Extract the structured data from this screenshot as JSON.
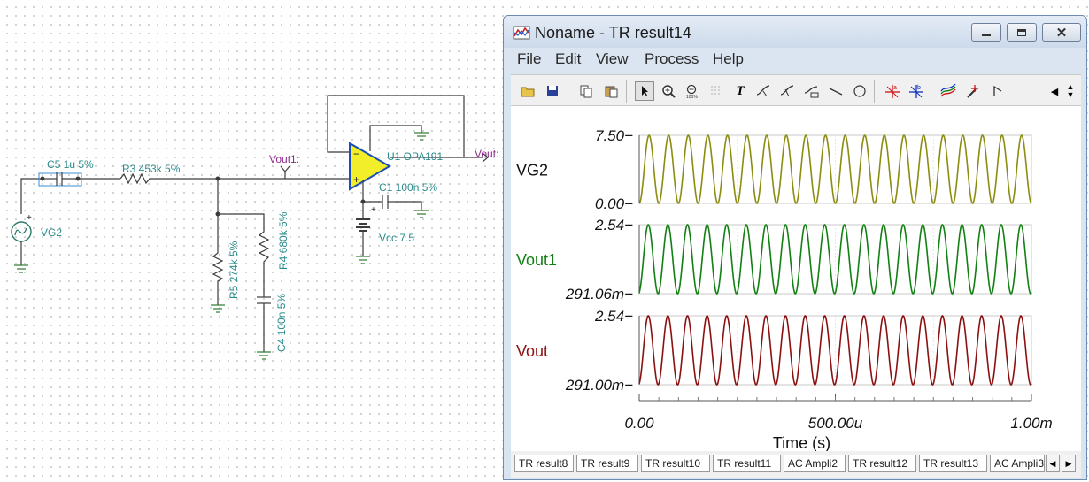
{
  "schematic": {
    "c5": "C5 1u 5%",
    "r3": "R3 453k 5%",
    "vout1_node": "Vout1:",
    "u1": "U1 OPA191",
    "vout_node": "Vout:",
    "c1": "C1 100n 5%",
    "vg2": "VG2",
    "vcc": "Vcc 7.5",
    "r5": "R5 274k 5%",
    "r4": "R4 680k 5%",
    "c4": "C4 100n 5%"
  },
  "window": {
    "title": "Noname - TR result14",
    "minimize_icon": "minimize-icon",
    "maximize_icon": "maximize-icon",
    "close_icon": "close-icon"
  },
  "menu": [
    "File",
    "Edit",
    "View",
    "Process",
    "Help"
  ],
  "toolbar_icons": [
    "open-folder-icon",
    "save-icon",
    "copy-icon",
    "paste-icon",
    "select-arrow-icon",
    "zoom-in-icon",
    "zoom-100-icon",
    "grid-icon",
    "text-icon",
    "curve-annotate-icon",
    "curve-annotate-2-icon",
    "curve-label-icon",
    "line-icon",
    "circle-icon",
    "cursor-a-icon",
    "cursor-b-icon",
    "add-curve-icon",
    "marker-icon",
    "flag-icon",
    "scroll-left-icon"
  ],
  "colors": {
    "vg2": "#8c8c10",
    "vout1": "#128012",
    "vout": "#8c1010",
    "selection": "#f2ee2a"
  },
  "chart_data": {
    "type": "line",
    "xlabel": "Time (s)",
    "x_ticks": [
      "0.00",
      "500.00u",
      "1.00m"
    ],
    "xlim": [
      0,
      0.001
    ],
    "grid": true,
    "panels": [
      {
        "name": "VG2",
        "ymax_label": "7.50",
        "ymin_label": "0.00",
        "ylim": [
          0,
          7.5
        ],
        "frequency_hz": 20000,
        "cycles": 20
      },
      {
        "name": "Vout1",
        "ymax_label": "2.54",
        "ymin_label": "291.06m",
        "ylim": [
          0.29106,
          2.54
        ],
        "frequency_hz": 20000,
        "cycles": 20
      },
      {
        "name": "Vout",
        "ymax_label": "2.54",
        "ymin_label": "291.00m",
        "ylim": [
          0.291,
          2.54
        ],
        "frequency_hz": 20000,
        "cycles": 20
      }
    ]
  },
  "tabs": [
    "TR result8",
    "TR result9",
    "TR result10",
    "TR result11",
    "AC Ampli2",
    "TR result12",
    "TR result13",
    "AC Ampli3"
  ]
}
